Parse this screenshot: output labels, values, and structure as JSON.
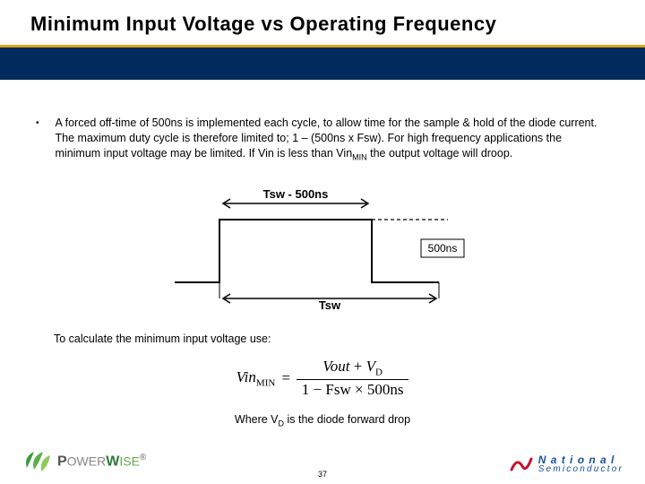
{
  "title": "Minimum Input Voltage vs Operating Frequency",
  "bullet": {
    "pre": "A forced off-time of 500ns is implemented each cycle, to allow time for the sample & hold of the diode current. The maximum duty cycle is therefore limited to; 1 – (500ns x Fsw). For high frequency applications the minimum input voltage may be limited. If Vin is less than Vin",
    "sub": "MIN",
    "post": " the output voltage will droop."
  },
  "diagram": {
    "label_top": "Tsw - 500ns",
    "label_right": "500ns",
    "label_bottom": "Tsw"
  },
  "calc_intro": "To calculate the minimum input voltage use:",
  "formula": {
    "lhs": "Vin",
    "lhs_sub": "MIN",
    "num_a": "Vout",
    "num_plus": "+",
    "num_b": "V",
    "num_b_sub": "D",
    "den": "1 − Fsw × 500ns"
  },
  "where": {
    "pre": "Where V",
    "sub": "D",
    "post": " is the diode forward drop"
  },
  "page_number": "37",
  "logos": {
    "powerwise": "PowerWise",
    "national": "National Semiconductor"
  },
  "chart_data": {
    "type": "table",
    "description": "Switching period timing diagram: one cycle of length Tsw with on-time = Tsw − 500ns (high) followed by forced off-time = 500ns (low).",
    "period_label": "Tsw",
    "on_time_label": "Tsw - 500ns",
    "off_time_label": "500ns",
    "off_time_ns": 500
  }
}
